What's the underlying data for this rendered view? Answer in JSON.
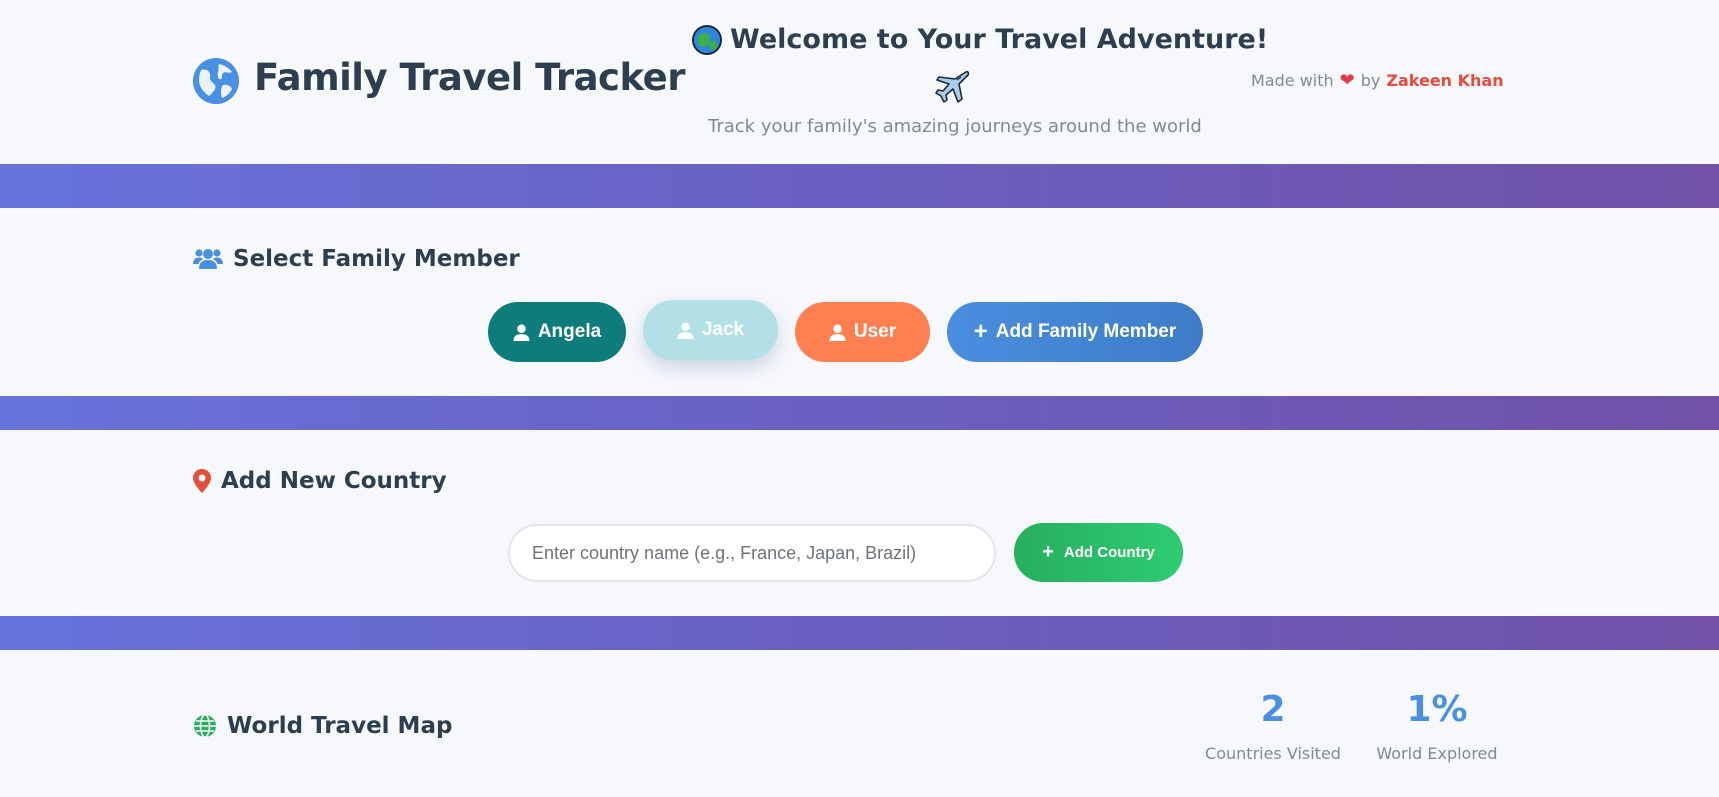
{
  "header": {
    "brand": "Family Travel Tracker",
    "welcome": "Welcome to Your Travel Adventure!",
    "tagline": "Track your family's amazing journeys around the world",
    "made_with": "Made with",
    "by": "by",
    "author": "Zakeen Khan"
  },
  "members_section": {
    "title": "Select Family Member",
    "members": [
      {
        "name": "Angela",
        "color": "#0e7c7b"
      },
      {
        "name": "Jack",
        "color": "#b2e0e6"
      },
      {
        "name": "User",
        "color": "#ff7f50"
      }
    ],
    "add_label": "Add Family Member"
  },
  "country_section": {
    "title": "Add New Country",
    "input_placeholder": "Enter country name (e.g., France, Japan, Brazil)",
    "input_value": "",
    "add_label": "Add Country"
  },
  "map_section": {
    "title": "World Travel Map",
    "stats": [
      {
        "value": "2",
        "label": "Countries Visited"
      },
      {
        "value": "1%",
        "label": "World Explored"
      }
    ]
  },
  "colors": {
    "accent": "#4a90e2",
    "band_start": "#6773dc",
    "band_end": "#7152a8",
    "author": "#e74c3c",
    "add_country": "#27ae60"
  }
}
